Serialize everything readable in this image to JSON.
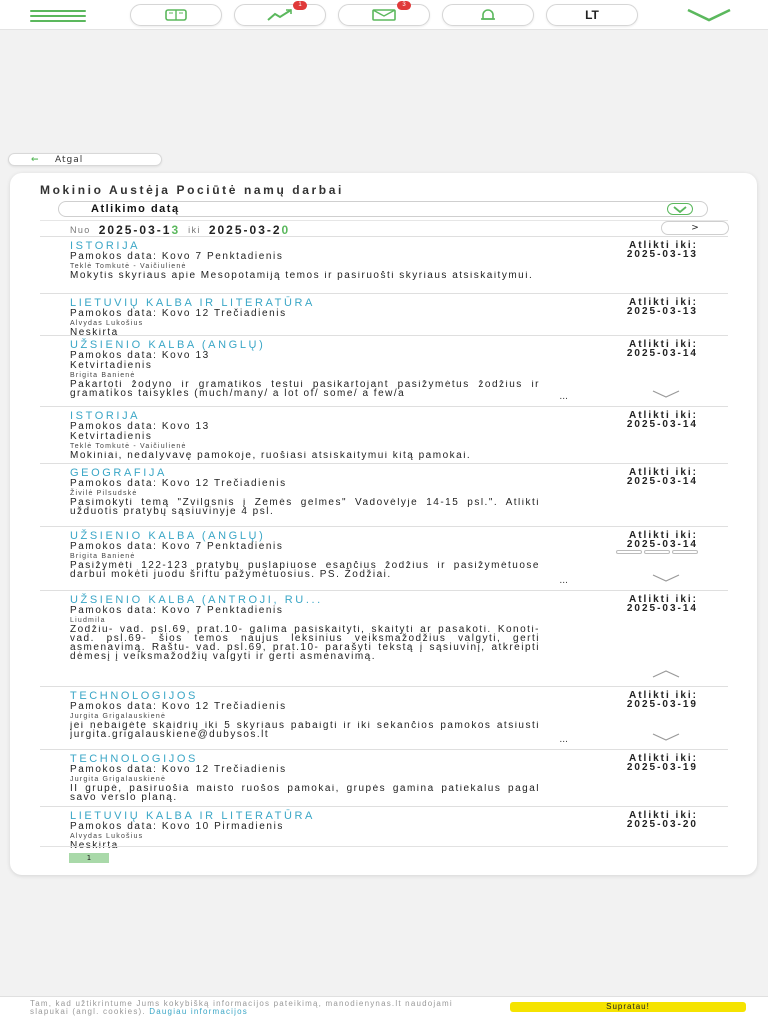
{
  "nav": {
    "language": "LT",
    "progress_badge": "1",
    "messages_badge": "3",
    "accent": "#5bb85d"
  },
  "back": {
    "label": "Atgal"
  },
  "page": {
    "title": "Mokinio Austėja Pociūtė namų darbai",
    "sort_label": "Atlikimo datą",
    "range_from_label": "Nuo",
    "range_from": "2025-03-1",
    "range_from_hl": "3",
    "range_to_label": "iki",
    "range_to": "2025-03-2",
    "range_to_hl": "0",
    "next_label": ">",
    "page_number": "1"
  },
  "homework": [
    {
      "subject": "ISTORIJA",
      "lesson": "Pamokos data: Kovo 7 Penktadienis",
      "teacher": "Teklė Tomkutė - Vaičiulienė",
      "desc": "Mokytis skyriaus apie Mesopotamiją temos ir pasiruošti skyriaus atsiskaitymui.",
      "due_label": "Atlikti iki:",
      "due": "2025-03-13"
    },
    {
      "subject": "LIETUVIŲ KALBA IR LITERATŪRA",
      "lesson": "Pamokos data: Kovo 12 Trečiadienis",
      "teacher": "Alvydas Lukošius",
      "desc": "Neskirta",
      "due_label": "Atlikti iki:",
      "due": "2025-03-13"
    },
    {
      "subject": "UŽSIENIO KALBA (ANGLŲ)",
      "lesson": "Pamokos data: Kovo 13",
      "lesson2": "Ketvirtadienis",
      "teacher": "Brigita Banienė",
      "desc": "Pakartoti žodyno ir gramatikos testui pasikartojant pasižymėtus žodžius ir gramatikos taisykles (much/many/ a lot of/ some/ a few/a",
      "dots": "...",
      "due_label": "Atlikti iki:",
      "due": "2025-03-14"
    },
    {
      "subject": "ISTORIJA",
      "lesson": "Pamokos data: Kovo 13",
      "lesson2": "Ketvirtadienis",
      "teacher": "Teklė Tomkutė - Vaičiulienė",
      "desc": "Mokiniai, nedalyvavę pamokoje, ruošiasi atsiskaitymui kitą pamokai.",
      "due_label": "Atlikti iki:",
      "due": "2025-03-14"
    },
    {
      "subject": "GEOGRAFIJA",
      "lesson": "Pamokos data: Kovo 12 Trečiadienis",
      "teacher": "Živilė Pilsudskė",
      "desc": "Pasimokyti temą \"Žvilgsnis į Žemės gelmes\" Vadovėlyje 14-15 psl.\". Atlikti užduotis pratybų sąsiuvinyje 4 psl.",
      "due_label": "Atlikti iki:",
      "due": "2025-03-14"
    },
    {
      "subject": "UŽSIENIO KALBA (ANGLŲ)",
      "lesson": "Pamokos data: Kovo 7 Penktadienis",
      "teacher": "Brigita Banienė",
      "desc": "Pasižymėti 122-123 pratybų puslapiuose esančius žodžius ir pasižymėtuose darbui mokėti juodu šriftu pažymėtuosius. PS. Žodžiai.",
      "dots": "...",
      "due_label": "Atlikti iki:",
      "due": "2025-03-14"
    },
    {
      "subject": "UŽSIENIO KALBA (ANTROJI, RU...",
      "lesson": "Pamokos data: Kovo 7 Penktadienis",
      "teacher": "Liudmila",
      "desc": "Žodžiu- vad. psl.69, prat.10- galima pasiskaityti, skaityti ar pasakoti. Konoti- vad. psl.69- šios temos naujus leksinius veiksmažodžius valgyti, gerti asmenavimą. Raštu- vad. psl.69, prat.10- parašyti tekstą į sąsiuvinį, atkreipti dėmesį į veiksmažodžių valgyti ir gerti asmenavimą.",
      "due_label": "Atlikti iki:",
      "due": "2025-03-14"
    },
    {
      "subject": "TECHNOLOGIJOS",
      "lesson": "Pamokos data: Kovo 12 Trečiadienis",
      "teacher": "Jurgita Grigalauskienė",
      "desc": "jei nebaigėte skaidrių iki 5 skyriaus pabaigti ir iki sekančios pamokos atsiusti jurgita.grigalauskiene@dubysos.lt",
      "dots": "...",
      "due_label": "Atlikti iki:",
      "due": "2025-03-19"
    },
    {
      "subject": "TECHNOLOGIJOS",
      "lesson": "Pamokos data: Kovo 12 Trečiadienis",
      "teacher": "Jurgita Grigalauskienė",
      "desc": "II grupė, pasiruošia maisto ruošos pamokai, grupės gamina patiekalus pagal savo verslo planą.",
      "due_label": "Atlikti iki:",
      "due": "2025-03-19"
    },
    {
      "subject": "LIETUVIŲ KALBA IR LITERATŪRA",
      "lesson": "Pamokos data: Kovo 10 Pirmadienis",
      "teacher": "Alvydas Lukošius",
      "desc": "Neskirta",
      "due_label": "Atlikti iki:",
      "due": "2025-03-20"
    }
  ],
  "cookie": {
    "text": "Tam, kad užtikrintume Jums kokybišką informacijos pateikimą, manodienynas.lt naudojami slapukai (angl. cookies).",
    "link": "Daugiau informacijos",
    "button": "Supratau!"
  }
}
